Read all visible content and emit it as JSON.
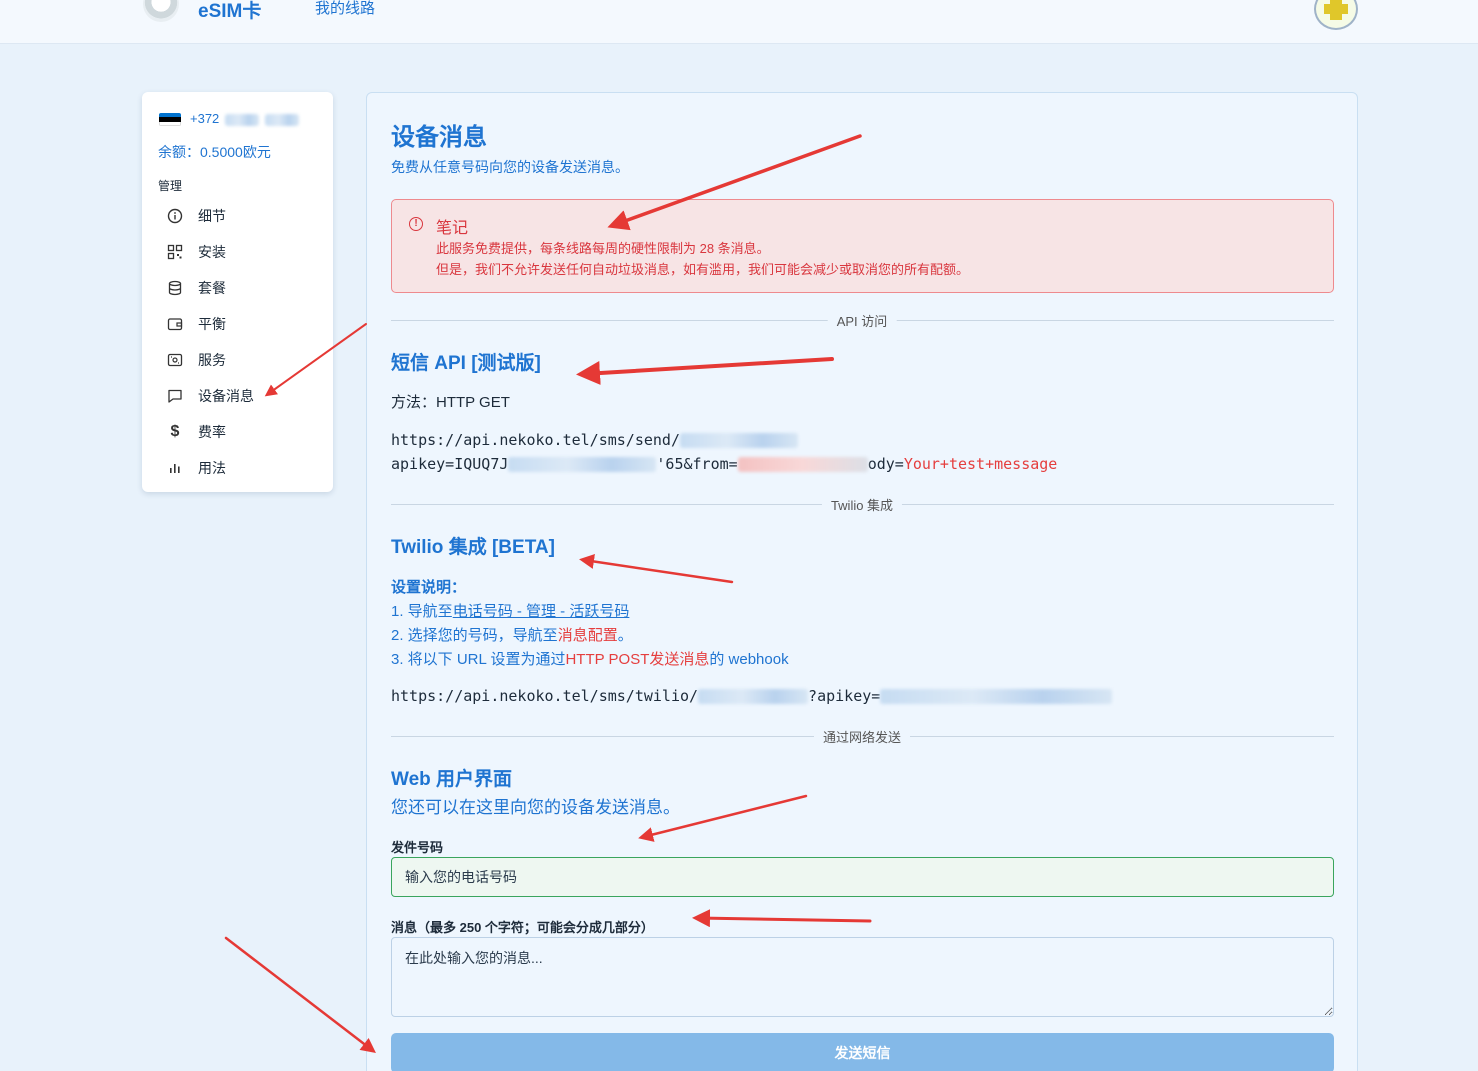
{
  "header": {
    "brand": "eSIM卡",
    "nav_my_lines": "我的线路"
  },
  "sidebar": {
    "flag_colors": [
      "#0072ce",
      "#000000",
      "#ffffff"
    ],
    "phone_prefix": "+372",
    "balance": "余额：0.5000欧元",
    "section_title": "管理",
    "items": [
      {
        "label": "细节",
        "icon": "info-circle-icon"
      },
      {
        "label": "安装",
        "icon": "qr-code-icon"
      },
      {
        "label": "套餐",
        "icon": "database-icon"
      },
      {
        "label": "平衡",
        "icon": "wallet-icon"
      },
      {
        "label": "服务",
        "icon": "router-icon"
      },
      {
        "label": "设备消息",
        "icon": "message-icon"
      },
      {
        "label": "费率",
        "icon": "dollar-icon"
      },
      {
        "label": "用法",
        "icon": "bar-chart-icon"
      }
    ]
  },
  "main": {
    "title": "设备消息",
    "subtitle": "免费从任意号码向您的设备发送消息。",
    "alert": {
      "title": "笔记",
      "line1": "此服务免费提供，每条线路每周的硬性限制为 28 条消息。",
      "line2": "但是，我们不允许发送任何自动垃圾消息，如有滥用，我们可能会减少或取消您的所有配额。"
    },
    "divider_api": "API 访问",
    "sms_api_title": "短信 API [测试版]",
    "method": "方法：HTTP GET",
    "api_url_line1": "https://api.nekoko.tel/sms/send/",
    "api_url_line2_a": "apikey=IQUQ7J",
    "api_url_line2_b": "'65&from=",
    "api_url_line2_c": "ody=",
    "api_url_line2_msg": "Your+test+message",
    "divider_twilio": "Twilio 集成",
    "twilio_title": "Twilio 集成 [BETA]",
    "setup_title": "设置说明：",
    "step1_prefix": "1. 导航至",
    "step1_link": "电话号码 - 管理 - 活跃号码",
    "step2_prefix": "2. 选择您的号码，导航至",
    "step2_highlight": "消息配置",
    "step2_suffix": "。",
    "step3_prefix": "3. 将以下 URL 设置为通过",
    "step3_highlight": "HTTP POST发送消息",
    "step3_suffix": "的 webhook",
    "twilio_url_a": "https://api.nekoko.tel/sms/twilio/",
    "twilio_url_b": "?apikey=",
    "divider_web": "通过网络发送",
    "web_title": "Web 用户界面",
    "web_subtitle": "您还可以在这里向您的设备发送消息。",
    "from_label": "发件号码",
    "from_placeholder": "输入您的电话号码",
    "message_label": "消息（最多 250 个字符；可能会分成几部分）",
    "message_placeholder": "在此处输入您的消息...",
    "send_button": "发送短信"
  },
  "colors": {
    "accent": "#1f74d1",
    "alert_red": "#d9363e",
    "annotation_arrow": "#e53935",
    "button_disabled": "#84b9e8"
  }
}
